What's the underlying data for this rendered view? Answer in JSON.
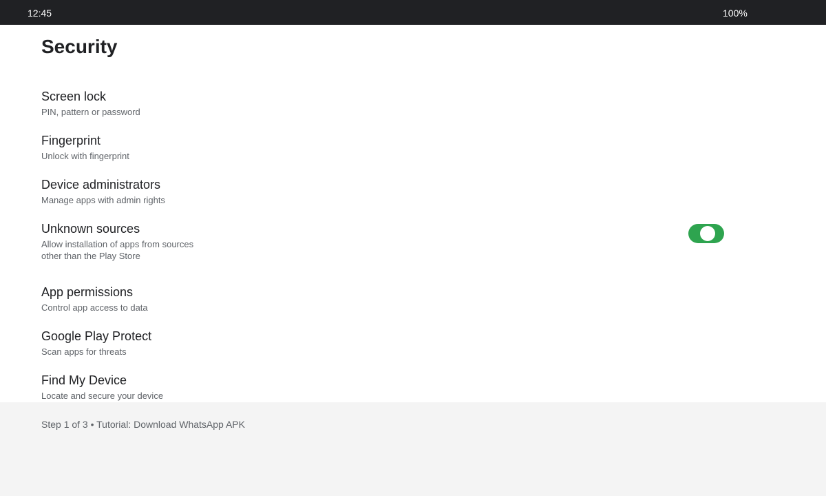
{
  "status_bar": {
    "time": "12:45",
    "battery": "100%"
  },
  "page": {
    "title": "Security"
  },
  "settings": [
    {
      "title": "Screen lock",
      "subtitle": "PIN, pattern or password"
    },
    {
      "title": "Fingerprint",
      "subtitle": "Unlock with fingerprint"
    },
    {
      "title": "Device administrators",
      "subtitle": "Manage apps with admin rights"
    },
    {
      "title": "Unknown sources",
      "subtitle": "Allow installation of apps from sources other than the Play Store",
      "toggle_on": true
    },
    {
      "title": "App permissions",
      "subtitle": "Control app access to data"
    },
    {
      "title": "Google Play Protect",
      "subtitle": "Scan apps for threats"
    },
    {
      "title": "Find My Device",
      "subtitle": "Locate and secure your device"
    }
  ],
  "footer": {
    "text": "Step 1 of 3 • Tutorial: Download WhatsApp APK"
  },
  "colors": {
    "status_bar_bg": "#202124",
    "toggle_on": "#2ea44f",
    "footer_bg": "#f4f4f4"
  }
}
